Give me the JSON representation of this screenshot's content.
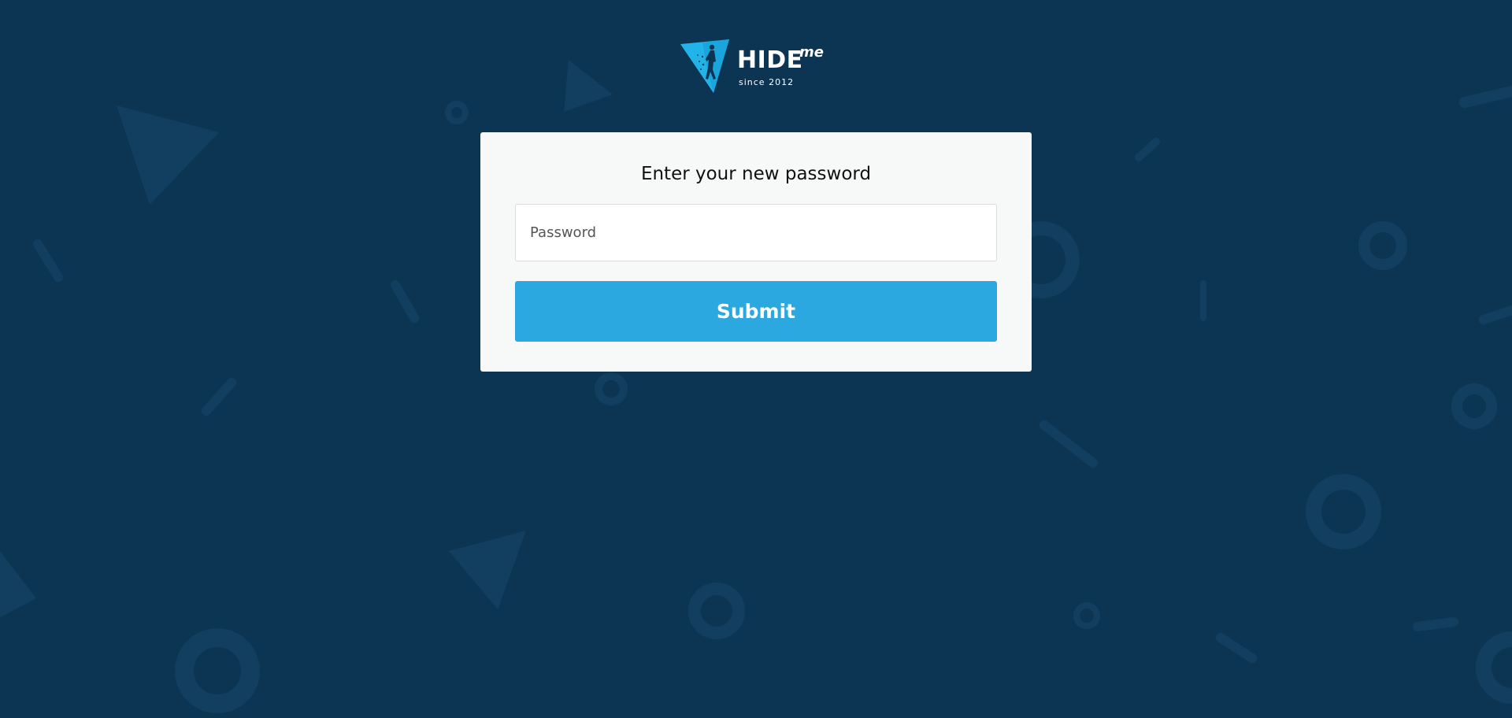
{
  "brand": {
    "name": "HIDE",
    "suffix": "me",
    "since": "since 2012",
    "logo_icon": "triangle-walker-logo-icon",
    "accent_color": "#2ba8df",
    "background_color": "#0c3553"
  },
  "form": {
    "title": "Enter your new password",
    "password_placeholder": "Password",
    "password_value": "",
    "submit_label": "Submit"
  }
}
